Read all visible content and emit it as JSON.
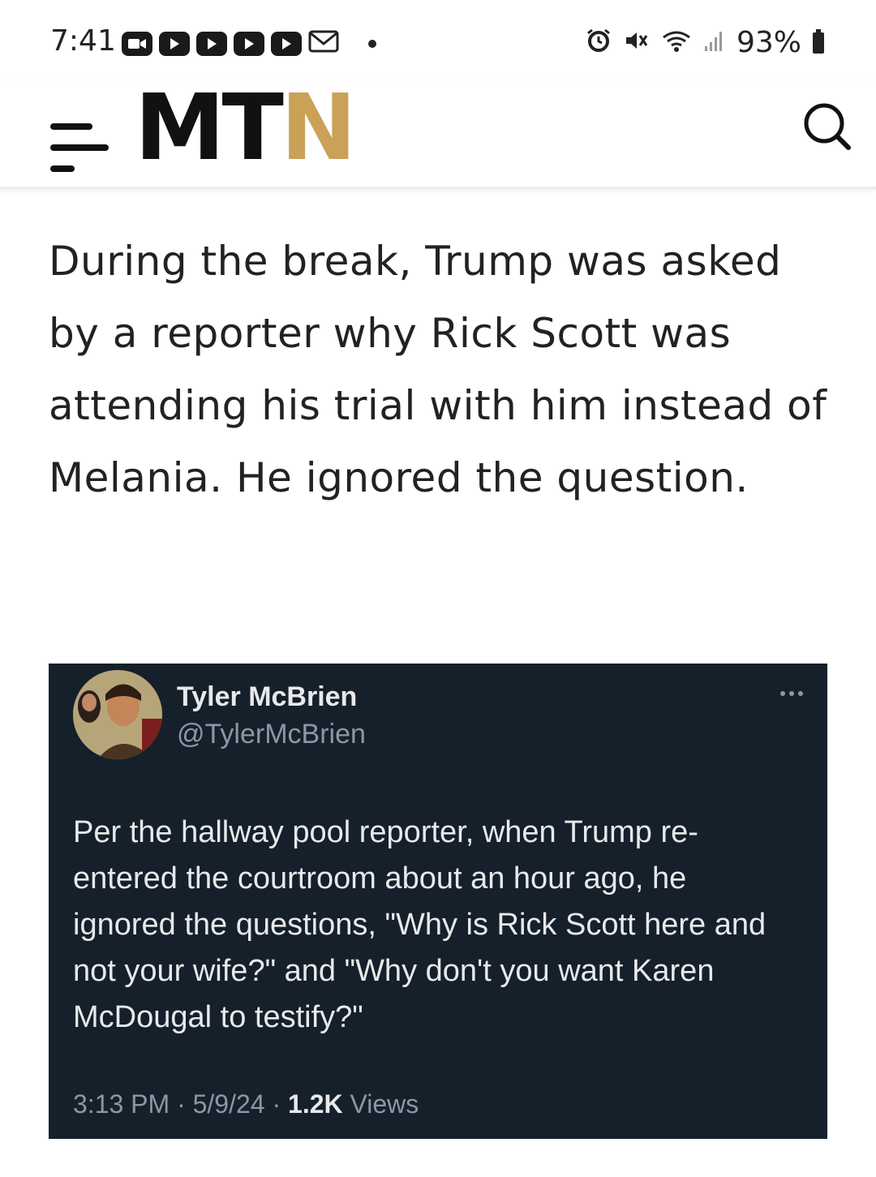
{
  "status_bar": {
    "time": "7:41",
    "battery": "93%"
  },
  "header": {
    "logo_part1": "MT",
    "logo_part2": "N",
    "logo_accent_color": "#c9a258"
  },
  "article": {
    "paragraph": "During the break, Trump was asked by a reporter why Rick Scott was attending his trial with him instead of Melania. He ignored the question."
  },
  "tweet": {
    "author_name": "Tyler McBrien",
    "author_handle": "@TylerMcBrien",
    "text": "Per the hallway pool reporter, when Trump re-entered the courtroom about an hour ago, he ignored the questions, \"Why is Rick Scott here and not your wife?\" and \"Why don't you want Karen McDougal to testify?\"",
    "time": "3:13 PM",
    "date": "5/9/24",
    "views_count": "1.2K",
    "views_label": "Views",
    "separator": "·",
    "background_color": "#15202b"
  }
}
